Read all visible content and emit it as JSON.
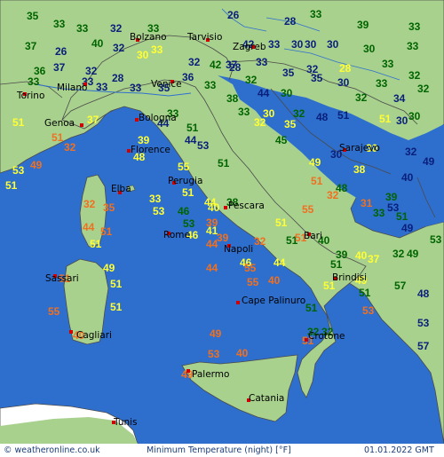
{
  "footer": {
    "copyright": "© weatheronline.co.uk",
    "title": "Minimum Temperature (night) [°F]",
    "date": "01.01.2022 GMT"
  },
  "colors": {
    "sea": "#2e6fce",
    "land": "#a9d18e",
    "out_land": "#ffffff",
    "border": "#4a4a4a",
    "text_orange": "#f07020",
    "text_yellow": "#ffff33",
    "text_green": "#006400",
    "text_navy": "#0a1f7a",
    "city_dot": "#d00000"
  },
  "cities": [
    "Tarvisio",
    "Bolzano",
    "Zagreb",
    "Torino",
    "Milano",
    "Venice",
    "Genoa",
    "Bologna",
    "Florence",
    "Perugia",
    "Elba",
    "Pescara",
    "Rome",
    "Bari",
    "Brindisi",
    "Sassari",
    "Napoli",
    "Cape Palinuro",
    "Cagliari",
    "Crotone",
    "Palermo",
    "Catania",
    "Tunis",
    "Sarajevo"
  ],
  "temperatures": [
    "35",
    "33",
    "33",
    "32",
    "33",
    "26",
    "28",
    "33",
    "39",
    "33",
    "37",
    "26",
    "40",
    "32",
    "33",
    "42",
    "33",
    "30",
    "30",
    "30",
    "30",
    "33",
    "36",
    "37",
    "32",
    "28",
    "30",
    "32",
    "42",
    "37",
    "28",
    "33",
    "35",
    "32",
    "28",
    "33",
    "32",
    "33",
    "33",
    "33",
    "33",
    "35",
    "36",
    "33",
    "32",
    "30",
    "35",
    "30",
    "32",
    "33",
    "34",
    "32",
    "38",
    "44",
    "33",
    "33",
    "30",
    "32",
    "48",
    "51",
    "51",
    "30",
    "51",
    "37",
    "51",
    "44",
    "32",
    "35",
    "30",
    "32",
    "39",
    "51",
    "44",
    "53",
    "45",
    "30",
    "30",
    "32",
    "49",
    "53",
    "48",
    "55",
    "51",
    "49",
    "38",
    "49",
    "51",
    "51",
    "48",
    "39",
    "40",
    "32",
    "35",
    "33",
    "51",
    "44",
    "40",
    "32",
    "31",
    "33",
    "51",
    "53",
    "53",
    "46",
    "39",
    "38",
    "51",
    "55",
    "44",
    "51",
    "53",
    "46",
    "41",
    "39",
    "32",
    "51",
    "51",
    "53",
    "49",
    "51",
    "44",
    "46",
    "44",
    "40",
    "39",
    "37",
    "32",
    "49",
    "49",
    "51",
    "44",
    "55",
    "51",
    "40",
    "55",
    "40",
    "51",
    "49",
    "51",
    "57",
    "48",
    "51",
    "51",
    "55",
    "51",
    "53",
    "40",
    "32",
    "32",
    "53",
    "49",
    "51",
    "57",
    "53",
    "40",
    "49"
  ]
}
